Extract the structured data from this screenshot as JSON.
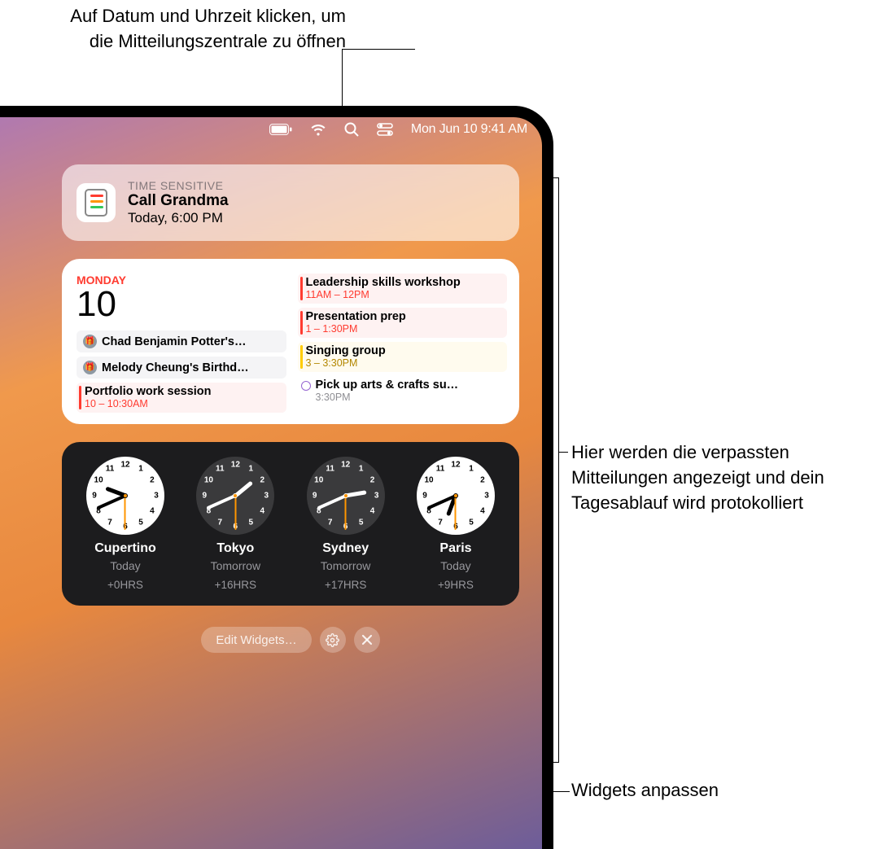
{
  "annotations": {
    "top": "Auf Datum und Uhrzeit klicken, um die Mitteilungszentrale zu öffnen",
    "right": "Hier werden die verpassten Mitteilungen angezeigt und dein Tagesablauf wird protokolliert",
    "bottom": "Widgets anpassen"
  },
  "menubar": {
    "datetime": "Mon Jun 10  9:41 AM"
  },
  "notification": {
    "tag": "TIME SENSITIVE",
    "title": "Call Grandma",
    "time": "Today, 6:00 PM"
  },
  "calendar": {
    "day": "MONDAY",
    "date": "10",
    "left": {
      "birthdays": [
        "Chad Benjamin Potter's…",
        "Melody Cheung's Birthd…"
      ],
      "event": {
        "title": "Portfolio work session",
        "time": "10 – 10:30AM"
      }
    },
    "right": [
      {
        "title": "Leadership skills workshop",
        "time": "11AM – 12PM",
        "color": "red"
      },
      {
        "title": "Presentation prep",
        "time": "1 – 1:30PM",
        "color": "red"
      },
      {
        "title": "Singing group",
        "time": "3 – 3:30PM",
        "color": "yellow"
      }
    ],
    "pickup": {
      "title": "Pick up arts & crafts su…",
      "time": "3:30PM"
    }
  },
  "clocks": [
    {
      "city": "Cupertino",
      "day": "Today",
      "offset": "+0HRS",
      "face": "light",
      "hour": 9,
      "minute": 41,
      "second": 30
    },
    {
      "city": "Tokyo",
      "day": "Tomorrow",
      "offset": "+16HRS",
      "face": "dark",
      "hour": 1,
      "minute": 41,
      "second": 30
    },
    {
      "city": "Sydney",
      "day": "Tomorrow",
      "offset": "+17HRS",
      "face": "dark",
      "hour": 2,
      "minute": 41,
      "second": 30
    },
    {
      "city": "Paris",
      "day": "Today",
      "offset": "+9HRS",
      "face": "light",
      "hour": 6,
      "minute": 41,
      "second": 30
    }
  ],
  "controls": {
    "edit": "Edit Widgets…"
  }
}
